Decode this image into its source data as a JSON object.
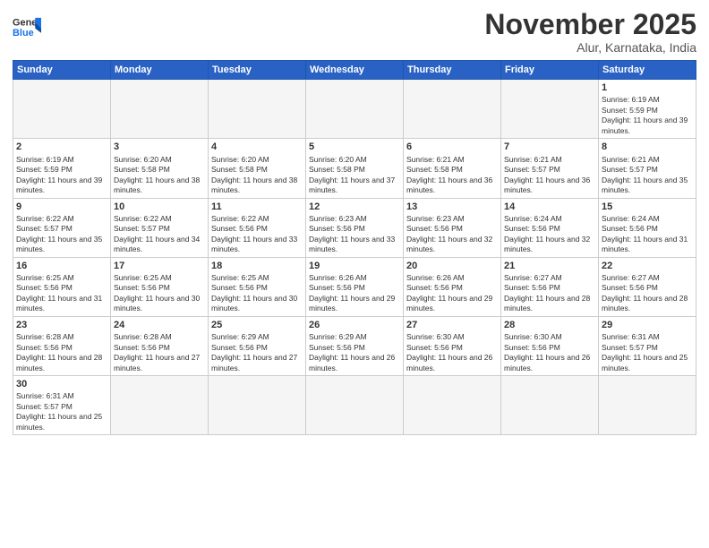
{
  "logo": {
    "text_general": "General",
    "text_blue": "Blue"
  },
  "header": {
    "month": "November 2025",
    "location": "Alur, Karnataka, India"
  },
  "weekdays": [
    "Sunday",
    "Monday",
    "Tuesday",
    "Wednesday",
    "Thursday",
    "Friday",
    "Saturday"
  ],
  "days": [
    {
      "num": "",
      "info": ""
    },
    {
      "num": "",
      "info": ""
    },
    {
      "num": "",
      "info": ""
    },
    {
      "num": "",
      "info": ""
    },
    {
      "num": "",
      "info": ""
    },
    {
      "num": "",
      "info": ""
    },
    {
      "num": "1",
      "sunrise": "6:19 AM",
      "sunset": "5:59 PM",
      "daylight": "11 hours and 39 minutes."
    },
    {
      "num": "2",
      "sunrise": "6:19 AM",
      "sunset": "5:59 PM",
      "daylight": "11 hours and 39 minutes."
    },
    {
      "num": "3",
      "sunrise": "6:20 AM",
      "sunset": "5:58 PM",
      "daylight": "11 hours and 38 minutes."
    },
    {
      "num": "4",
      "sunrise": "6:20 AM",
      "sunset": "5:58 PM",
      "daylight": "11 hours and 38 minutes."
    },
    {
      "num": "5",
      "sunrise": "6:20 AM",
      "sunset": "5:58 PM",
      "daylight": "11 hours and 37 minutes."
    },
    {
      "num": "6",
      "sunrise": "6:21 AM",
      "sunset": "5:58 PM",
      "daylight": "11 hours and 36 minutes."
    },
    {
      "num": "7",
      "sunrise": "6:21 AM",
      "sunset": "5:57 PM",
      "daylight": "11 hours and 36 minutes."
    },
    {
      "num": "8",
      "sunrise": "6:21 AM",
      "sunset": "5:57 PM",
      "daylight": "11 hours and 35 minutes."
    },
    {
      "num": "9",
      "sunrise": "6:22 AM",
      "sunset": "5:57 PM",
      "daylight": "11 hours and 35 minutes."
    },
    {
      "num": "10",
      "sunrise": "6:22 AM",
      "sunset": "5:57 PM",
      "daylight": "11 hours and 34 minutes."
    },
    {
      "num": "11",
      "sunrise": "6:22 AM",
      "sunset": "5:56 PM",
      "daylight": "11 hours and 33 minutes."
    },
    {
      "num": "12",
      "sunrise": "6:23 AM",
      "sunset": "5:56 PM",
      "daylight": "11 hours and 33 minutes."
    },
    {
      "num": "13",
      "sunrise": "6:23 AM",
      "sunset": "5:56 PM",
      "daylight": "11 hours and 32 minutes."
    },
    {
      "num": "14",
      "sunrise": "6:24 AM",
      "sunset": "5:56 PM",
      "daylight": "11 hours and 32 minutes."
    },
    {
      "num": "15",
      "sunrise": "6:24 AM",
      "sunset": "5:56 PM",
      "daylight": "11 hours and 31 minutes."
    },
    {
      "num": "16",
      "sunrise": "6:25 AM",
      "sunset": "5:56 PM",
      "daylight": "11 hours and 31 minutes."
    },
    {
      "num": "17",
      "sunrise": "6:25 AM",
      "sunset": "5:56 PM",
      "daylight": "11 hours and 30 minutes."
    },
    {
      "num": "18",
      "sunrise": "6:25 AM",
      "sunset": "5:56 PM",
      "daylight": "11 hours and 30 minutes."
    },
    {
      "num": "19",
      "sunrise": "6:26 AM",
      "sunset": "5:56 PM",
      "daylight": "11 hours and 29 minutes."
    },
    {
      "num": "20",
      "sunrise": "6:26 AM",
      "sunset": "5:56 PM",
      "daylight": "11 hours and 29 minutes."
    },
    {
      "num": "21",
      "sunrise": "6:27 AM",
      "sunset": "5:56 PM",
      "daylight": "11 hours and 28 minutes."
    },
    {
      "num": "22",
      "sunrise": "6:27 AM",
      "sunset": "5:56 PM",
      "daylight": "11 hours and 28 minutes."
    },
    {
      "num": "23",
      "sunrise": "6:28 AM",
      "sunset": "5:56 PM",
      "daylight": "11 hours and 28 minutes."
    },
    {
      "num": "24",
      "sunrise": "6:28 AM",
      "sunset": "5:56 PM",
      "daylight": "11 hours and 27 minutes."
    },
    {
      "num": "25",
      "sunrise": "6:29 AM",
      "sunset": "5:56 PM",
      "daylight": "11 hours and 27 minutes."
    },
    {
      "num": "26",
      "sunrise": "6:29 AM",
      "sunset": "5:56 PM",
      "daylight": "11 hours and 26 minutes."
    },
    {
      "num": "27",
      "sunrise": "6:30 AM",
      "sunset": "5:56 PM",
      "daylight": "11 hours and 26 minutes."
    },
    {
      "num": "28",
      "sunrise": "6:30 AM",
      "sunset": "5:56 PM",
      "daylight": "11 hours and 26 minutes."
    },
    {
      "num": "29",
      "sunrise": "6:31 AM",
      "sunset": "5:57 PM",
      "daylight": "11 hours and 25 minutes."
    },
    {
      "num": "30",
      "sunrise": "6:31 AM",
      "sunset": "5:57 PM",
      "daylight": "11 hours and 25 minutes."
    }
  ],
  "labels": {
    "sunrise": "Sunrise:",
    "sunset": "Sunset:",
    "daylight": "Daylight:"
  }
}
